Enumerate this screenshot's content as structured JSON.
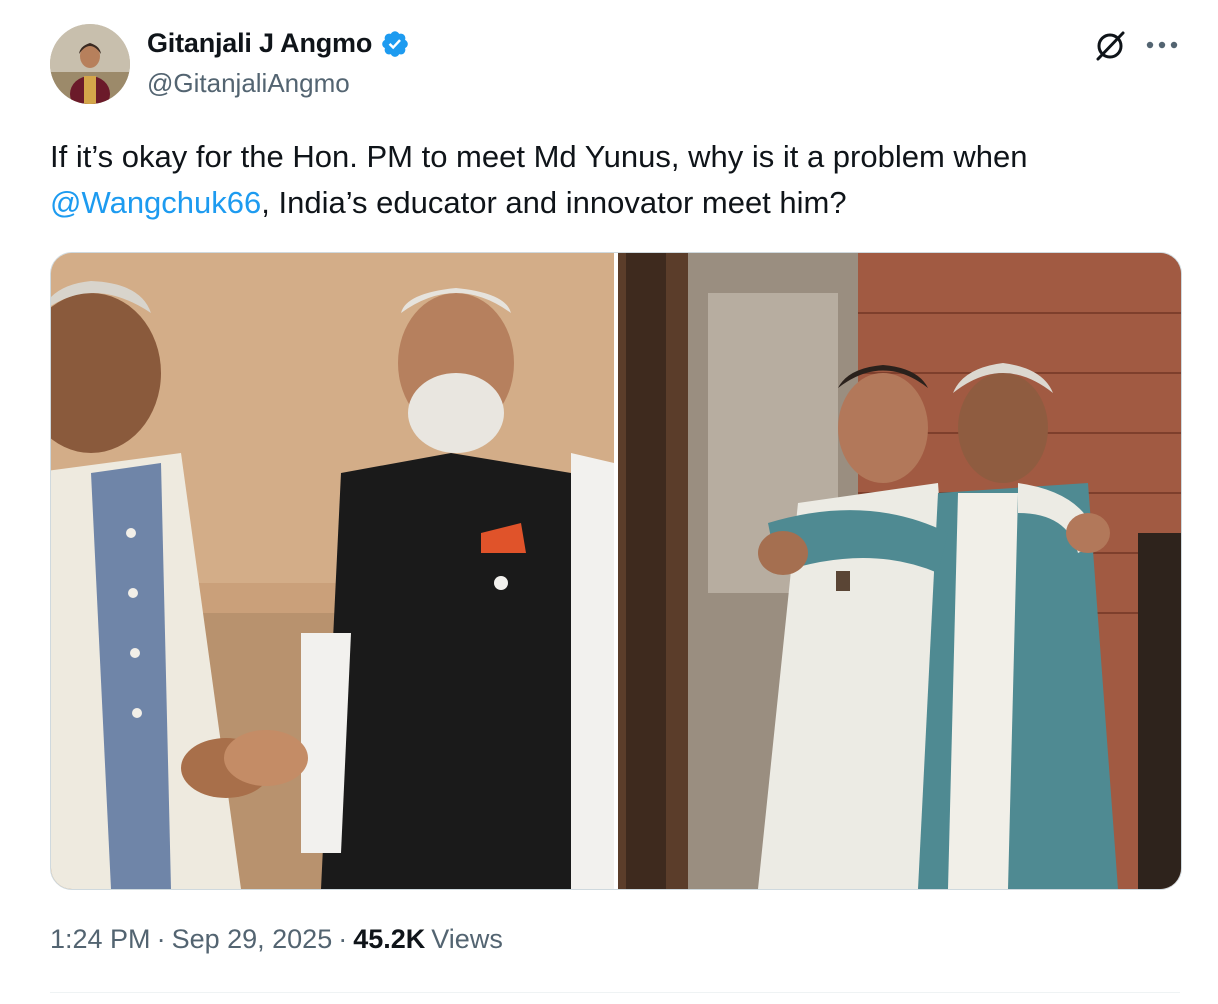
{
  "author": {
    "name": "Gitanjali J Angmo",
    "handle": "@GitanjaliAngmo",
    "verified": true,
    "avatar_icon": "profile-photo"
  },
  "actions": {
    "grok_icon": "grok-icon",
    "more_icon": "more-icon"
  },
  "tweet": {
    "text_before": "If it’s okay for the Hon. PM to meet Md Yunus, why is it a problem when ",
    "mention": "@Wangchuk66",
    "text_after": ", India’s educator and innovator meet him?"
  },
  "media": {
    "count": 2
  },
  "meta": {
    "time": "1:24 PM",
    "separator": "·",
    "date": "Sep 29, 2025",
    "views_count": "45.2K",
    "views_label": "Views"
  },
  "colors": {
    "link": "#1d9bf0",
    "verified": "#1d9bf0",
    "text_primary": "#0f1419",
    "text_secondary": "#536471",
    "border": "#cfd9de"
  }
}
